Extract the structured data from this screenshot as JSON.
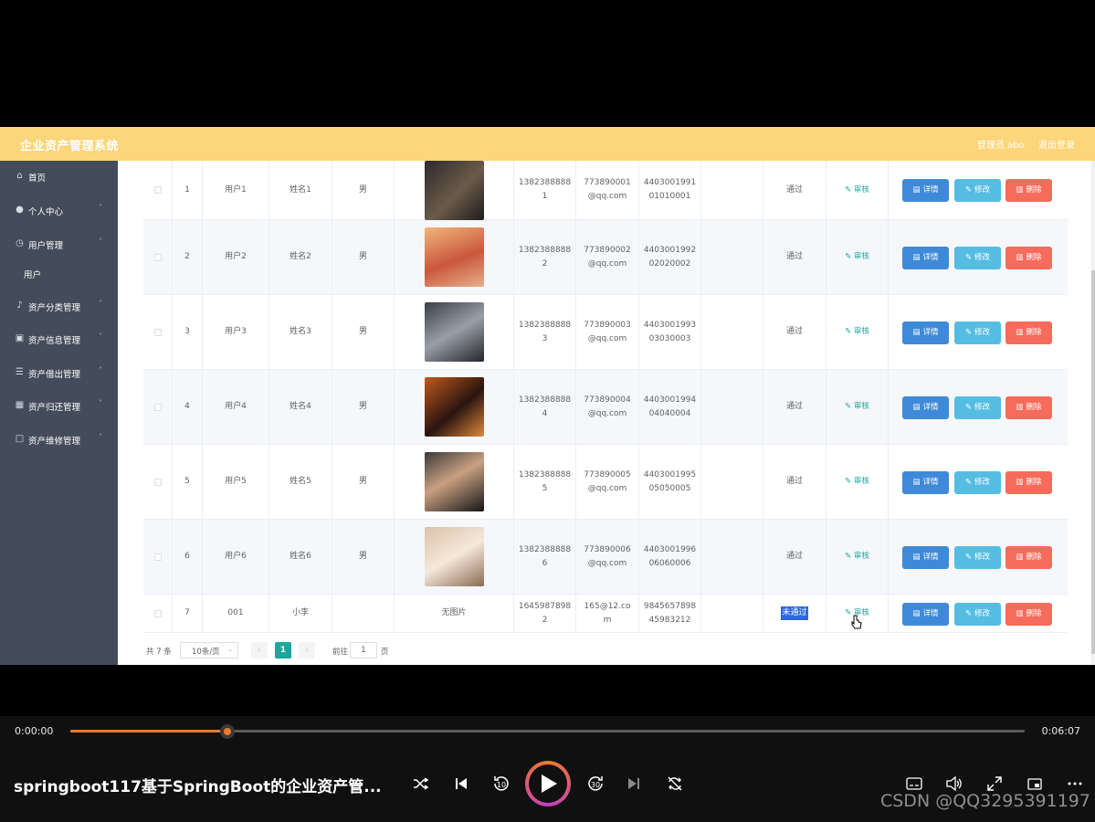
{
  "header": {
    "title": "企业资产管理系统",
    "admin": "管理员 abo",
    "logout": "退出登录"
  },
  "sidebar": {
    "items": [
      {
        "label": "首页",
        "icon": "home-icon"
      },
      {
        "label": "个人中心",
        "icon": "user-icon"
      },
      {
        "label": "用户管理",
        "icon": "clock-icon"
      },
      {
        "label": "用户",
        "icon": ""
      },
      {
        "label": "资产分类管理",
        "icon": "bell-icon"
      },
      {
        "label": "资产信息管理",
        "icon": "picture-icon"
      },
      {
        "label": "资产借出管理",
        "icon": "list-icon"
      },
      {
        "label": "资产归还管理",
        "icon": "grid-icon"
      },
      {
        "label": "资产维修管理",
        "icon": "crop-icon"
      }
    ]
  },
  "table": {
    "actions": {
      "review": "审核",
      "detail": "详情",
      "edit": "修改",
      "delete": "删除"
    },
    "rows": [
      {
        "index": "1",
        "account": "用户1",
        "name": "姓名1",
        "gender": "男",
        "phone": "13823888881",
        "email": "773890001@qq.com",
        "idcard": "440300199101010001",
        "status": "通过",
        "photo": "photo-1"
      },
      {
        "index": "2",
        "account": "用户2",
        "name": "姓名2",
        "gender": "男",
        "phone": "13823888882",
        "email": "773890002@qq.com",
        "idcard": "440300199202020002",
        "status": "通过",
        "photo": "photo-2"
      },
      {
        "index": "3",
        "account": "用户3",
        "name": "姓名3",
        "gender": "男",
        "phone": "13823888883",
        "email": "773890003@qq.com",
        "idcard": "440300199303030003",
        "status": "通过",
        "photo": "photo-3"
      },
      {
        "index": "4",
        "account": "用户4",
        "name": "姓名4",
        "gender": "男",
        "phone": "13823888884",
        "email": "773890004@qq.com",
        "idcard": "440300199404040004",
        "status": "通过",
        "photo": "photo-4"
      },
      {
        "index": "5",
        "account": "用户5",
        "name": "姓名5",
        "gender": "男",
        "phone": "13823888885",
        "email": "773890005@qq.com",
        "idcard": "440300199505050005",
        "status": "通过",
        "photo": "photo-5"
      },
      {
        "index": "6",
        "account": "用户6",
        "name": "姓名6",
        "gender": "男",
        "phone": "13823888886",
        "email": "773890006@qq.com",
        "idcard": "440300199606060006",
        "status": "通过",
        "photo": "photo-6"
      },
      {
        "index": "7",
        "account": "001",
        "name": "小李",
        "gender": "",
        "phone": "16459878982",
        "email": "165@12.com",
        "idcard": "984565789845983212",
        "status": "未通过",
        "photo": "无图片"
      }
    ],
    "phone_split": [
      [
        "1382388888",
        "1"
      ],
      [
        "1382388888",
        "2"
      ],
      [
        "1382388888",
        "3"
      ],
      [
        "1382388888",
        "4"
      ],
      [
        "1382388888",
        "5"
      ],
      [
        "1382388888",
        "6"
      ],
      [
        "1645987898",
        "2"
      ]
    ],
    "email_split": [
      [
        "773890001",
        "@qq.com"
      ],
      [
        "773890002",
        "@qq.com"
      ],
      [
        "773890003",
        "@qq.com"
      ],
      [
        "773890004",
        "@qq.com"
      ],
      [
        "773890005",
        "@qq.com"
      ],
      [
        "773890006",
        "@qq.com"
      ],
      [
        "165@12.co",
        "m"
      ]
    ],
    "idcard_split": [
      [
        "4403001991",
        "01010001"
      ],
      [
        "4403001992",
        "02020002"
      ],
      [
        "4403001993",
        "03030003"
      ],
      [
        "4403001994",
        "04040004"
      ],
      [
        "4403001995",
        "05050005"
      ],
      [
        "4403001996",
        "06060006"
      ],
      [
        "9845657898",
        "45983212"
      ]
    ]
  },
  "pagination": {
    "total": "共 7 条",
    "page_size": "10条/页",
    "current": "1",
    "goto": "前往",
    "goto_value": "1",
    "page_unit": "页"
  },
  "player": {
    "title": "springboot117基于SpringBoot的企业资产管...",
    "current_time": "0:00:00",
    "total_time": "0:06:07",
    "progress_fraction": 0.165,
    "watermark": "CSDN @QQ3295391197",
    "accent": "#f07a2a"
  }
}
